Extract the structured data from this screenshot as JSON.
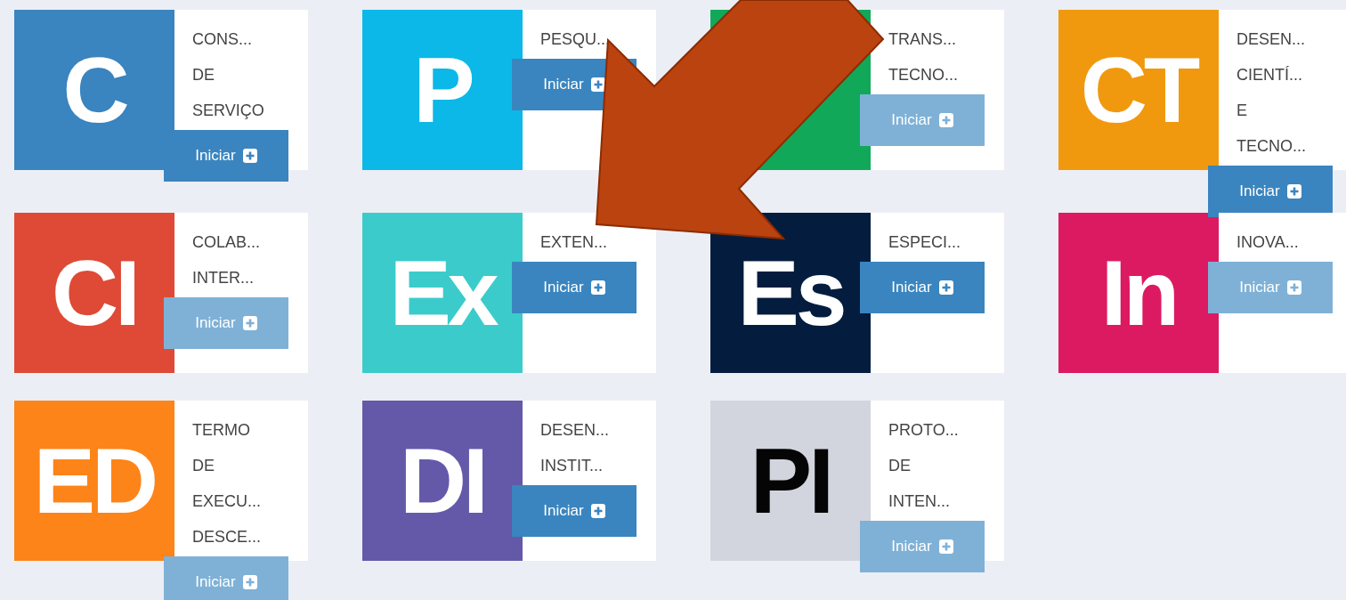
{
  "cards": [
    {
      "letter": "C",
      "color": "#3a84bf",
      "lines": [
        "CONS...",
        "DE",
        "SERVIÇO"
      ],
      "button": {
        "label": "Iniciar",
        "disabled": false
      }
    },
    {
      "letter": "P",
      "color": "#0bb8e8",
      "lines": [
        "PESQU..."
      ],
      "button": {
        "label": "Iniciar",
        "disabled": false
      }
    },
    {
      "color": "#11a85a",
      "lines": [
        "TRANS...",
        "TECNO..."
      ],
      "button": {
        "label": "Iniciar",
        "disabled": true
      }
    },
    {
      "letter": "CT",
      "color": "#f0990f",
      "lines": [
        "DESEN...",
        "CIENTÍ...",
        "E",
        "TECNO..."
      ],
      "button": {
        "label": "Iniciar",
        "disabled": false
      }
    },
    {
      "letter": "CI",
      "color": "#de4a36",
      "lines": [
        "COLAB...",
        "INTER..."
      ],
      "button": {
        "label": "Iniciar",
        "disabled": true
      }
    },
    {
      "letter": "Ex",
      "color": "#3ccbcb",
      "lines": [
        "EXTEN..."
      ],
      "button": {
        "label": "Iniciar",
        "disabled": false
      }
    },
    {
      "letter": "Es",
      "color": "#041d3f",
      "lines": [
        "ESPECI..."
      ],
      "button": {
        "label": "Iniciar",
        "disabled": false
      }
    },
    {
      "letter": "In",
      "color": "#dc1a62",
      "lines": [
        "INOVA..."
      ],
      "button": {
        "label": "Iniciar",
        "disabled": true
      }
    },
    {
      "letter": "ED",
      "color": "#fd8418",
      "lines": [
        "TERMO",
        "DE",
        "EXECU...",
        "DESCE..."
      ],
      "button": {
        "label": "Iniciar",
        "disabled": true
      }
    },
    {
      "letter": "DI",
      "color": "#6459a9",
      "lines": [
        "DESEN...",
        "INSTIT..."
      ],
      "button": {
        "label": "Iniciar",
        "disabled": false
      }
    },
    {
      "letter": "PI",
      "color": "#d2d5dd",
      "lines": [
        "PROTO...",
        "DE",
        "INTEN..."
      ],
      "button": {
        "label": "Iniciar",
        "disabled": true
      }
    }
  ]
}
